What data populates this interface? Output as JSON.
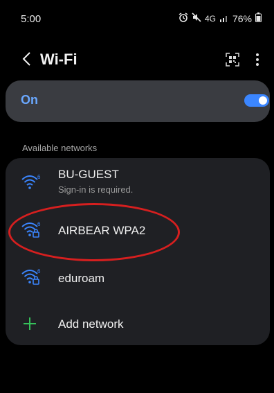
{
  "status_bar": {
    "time": "5:00",
    "network": "4G",
    "battery": "76%"
  },
  "header": {
    "title": "Wi-Fi",
    "back_icon": "chevron-left-icon",
    "qr_icon": "qr-scan-icon",
    "more_icon": "more-vert-icon"
  },
  "wifi_toggle": {
    "label": "On",
    "state": "on",
    "accent": "#3b86ff"
  },
  "available": {
    "section_label": "Available networks",
    "networks": [
      {
        "name": "BU-GUEST",
        "sub": "Sign-in is required.",
        "secured": false,
        "badge": "6"
      },
      {
        "name": "AIRBEAR WPA2",
        "sub": "",
        "secured": true,
        "badge": "6"
      },
      {
        "name": "eduroam",
        "sub": "",
        "secured": true,
        "badge": "6"
      }
    ],
    "add_network": "Add network"
  },
  "colors": {
    "background": "#000000",
    "card": "#1f2024",
    "toggle_card": "#3a3c41",
    "wifi_icon": "#3b86ff",
    "add_icon": "#35c15a",
    "annotation": "#d61f1f"
  }
}
